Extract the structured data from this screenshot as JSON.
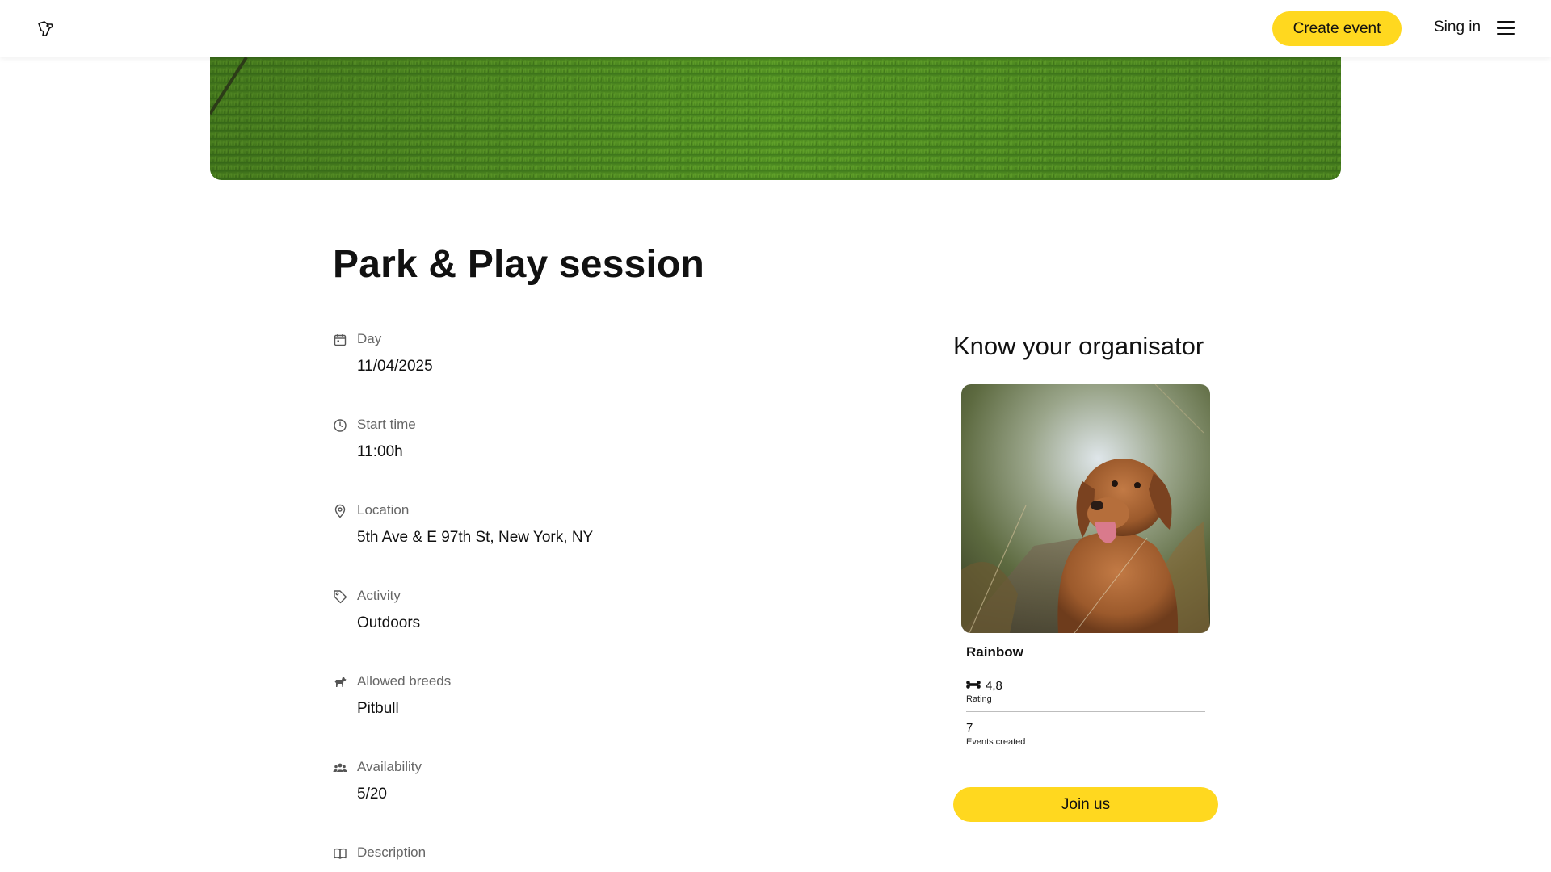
{
  "header": {
    "logo_icon": "dog-paw-logo-icon",
    "create_event_label": "Create event",
    "signin_label": "Sing in",
    "menu_icon": "hamburger-menu-icon",
    "accent_color": "#FFD81F"
  },
  "hero": {
    "image": "green-grass-field"
  },
  "event": {
    "title": "Park & Play session",
    "details": [
      {
        "icon": "calendar-icon",
        "label": "Day",
        "value": "11/04/2025"
      },
      {
        "icon": "clock-icon",
        "label": "Start time",
        "value": "11:00h"
      },
      {
        "icon": "location-pin-icon",
        "label": "Location",
        "value": "5th Ave & E 97th St, New York, NY"
      },
      {
        "icon": "tag-icon",
        "label": "Activity",
        "value": "Outdoors"
      },
      {
        "icon": "dog-icon",
        "label": "Allowed breeds",
        "value": "Pitbull"
      },
      {
        "icon": "people-icon",
        "label": "Availability",
        "value": "5/20"
      },
      {
        "icon": "book-icon",
        "label": "Description",
        "value": ""
      }
    ]
  },
  "organizer": {
    "heading": "Know your organisator",
    "photo": "brown-dog-photo",
    "name": "Rainbow",
    "rating_icon": "bone-icon",
    "rating_value": "4,8",
    "rating_label": "Rating",
    "events_value": "7",
    "events_label": "Events created",
    "join_label": "Join us"
  }
}
